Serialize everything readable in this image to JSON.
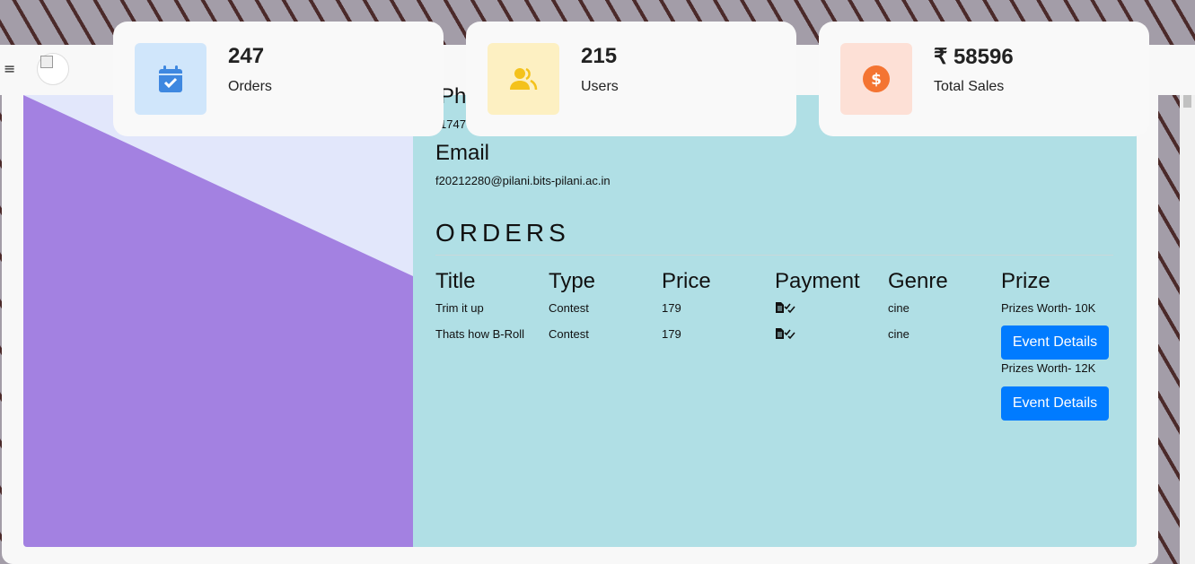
{
  "navbar": {
    "menu_glyph": "≡"
  },
  "stats": [
    {
      "value": "247",
      "label": "Orders",
      "icon": "calendar-check-icon",
      "bg": "#d0e6fb",
      "color": "#3f88e0"
    },
    {
      "value": "215",
      "label": "Users",
      "icon": "users-icon",
      "bg": "#fdf0c2",
      "color": "#f4c21c"
    },
    {
      "value": "₹ 58596",
      "label": "Total Sales",
      "icon": "dollar-circle-icon",
      "bg": "#fde0d6",
      "color": "#f47432"
    }
  ],
  "profile": {
    "phone_heading": "Pho",
    "phone_value": "1747",
    "email_heading": "Email",
    "email_value": "f20212280@pilani.bits-pilani.ac.in"
  },
  "orders": {
    "heading": "ORDERS",
    "columns": [
      "Title",
      "Type",
      "Price",
      "Payment",
      "Genre",
      "Prize"
    ],
    "rows": [
      {
        "title": "Trim it up",
        "type": "Contest",
        "price": "179",
        "payment_icon": "payment-verified-icon",
        "genre": "cine",
        "prize": "Prizes Worth- 10K",
        "button": "Event Details"
      },
      {
        "title": "Thats how B-Roll",
        "type": "Contest",
        "price": "179",
        "payment_icon": "payment-verified-icon",
        "genre": "cine",
        "prize": "Prizes Worth- 12K",
        "button": "Event Details"
      }
    ]
  },
  "colors": {
    "panel_left": "#a381e1",
    "panel_left_light": "#e2e7fb",
    "panel_right": "#b0dfe5",
    "button": "#007bff"
  }
}
